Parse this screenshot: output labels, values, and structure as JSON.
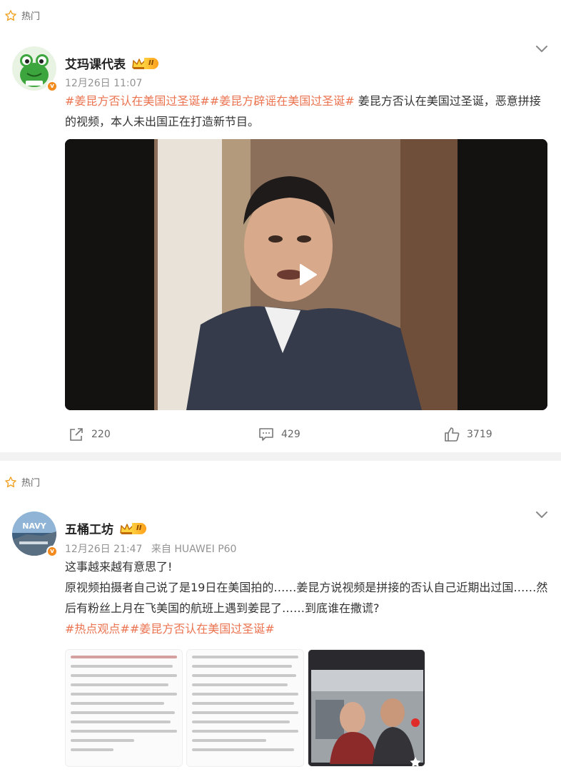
{
  "posts": [
    {
      "hot_label": "热门",
      "username": "艾玛课代表",
      "level": "II",
      "meta": {
        "time": "12月26日 11:07"
      },
      "content": {
        "tag1": "#姜昆方否认在美国过圣诞#",
        "tag2": "#姜昆方辟谣在美国过圣诞#",
        "text": " 姜昆方否认在美国过圣诞，恶意拼接的视频，本人未出国正在打造新节目。"
      },
      "actions": {
        "reposts": "220",
        "comments": "429",
        "likes": "3719"
      }
    },
    {
      "hot_label": "热门",
      "username": "五桶工坊",
      "level": "II",
      "meta": {
        "time": "12月26日 21:47",
        "source": "来自 HUAWEI P60"
      },
      "content": {
        "line1": "这事越来越有意思了!",
        "line2": "原视频拍摄者自己说了是19日在美国拍的……姜昆方说视频是拼接的否认自己近期出过国……然后有粉丝上月在飞美国的航班上遇到姜昆了……到底谁在撒谎?",
        "tag1": "#热点观点#",
        "tag2": "#姜昆方否认在美国过圣诞#"
      },
      "avatar_text": "NAVY"
    }
  ],
  "colors": {
    "accent": "#eb7350",
    "muted": "#939393",
    "badge": "#f28a1e"
  },
  "icons": [
    "star-outline-icon",
    "chevron-down-icon",
    "play-icon",
    "repost-icon",
    "comment-icon",
    "like-icon"
  ]
}
